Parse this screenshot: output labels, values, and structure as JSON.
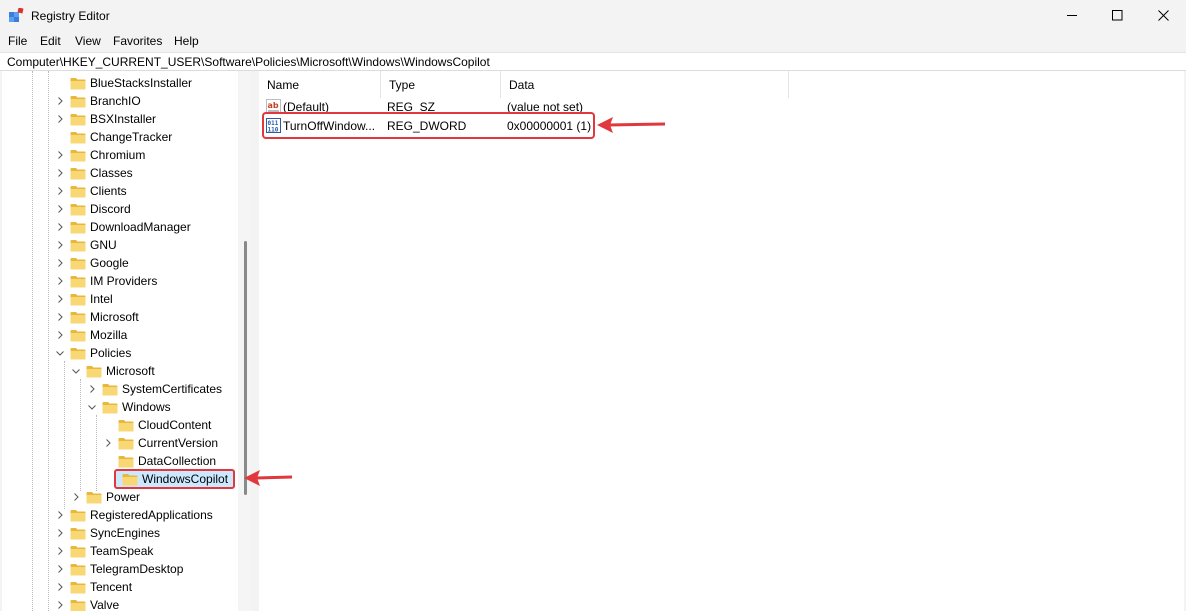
{
  "window": {
    "title": "Registry Editor",
    "controls": [
      "minimize",
      "maximize",
      "close"
    ]
  },
  "menu": [
    "File",
    "Edit",
    "View",
    "Favorites",
    "Help"
  ],
  "address": "Computer\\HKEY_CURRENT_USER\\Software\\Policies\\Microsoft\\Windows\\WindowsCopilot",
  "tree": [
    {
      "label": "BlueStacksInstaller",
      "level": 0,
      "chevron": "none"
    },
    {
      "label": "BranchIO",
      "level": 0,
      "chevron": "right"
    },
    {
      "label": "BSXInstaller",
      "level": 0,
      "chevron": "right"
    },
    {
      "label": "ChangeTracker",
      "level": 0,
      "chevron": "none"
    },
    {
      "label": "Chromium",
      "level": 0,
      "chevron": "right"
    },
    {
      "label": "Classes",
      "level": 0,
      "chevron": "right"
    },
    {
      "label": "Clients",
      "level": 0,
      "chevron": "right"
    },
    {
      "label": "Discord",
      "level": 0,
      "chevron": "right"
    },
    {
      "label": "DownloadManager",
      "level": 0,
      "chevron": "right"
    },
    {
      "label": "GNU",
      "level": 0,
      "chevron": "right"
    },
    {
      "label": "Google",
      "level": 0,
      "chevron": "right"
    },
    {
      "label": "IM Providers",
      "level": 0,
      "chevron": "right"
    },
    {
      "label": "Intel",
      "level": 0,
      "chevron": "right"
    },
    {
      "label": "Microsoft",
      "level": 0,
      "chevron": "right"
    },
    {
      "label": "Mozilla",
      "level": 0,
      "chevron": "right"
    },
    {
      "label": "Policies",
      "level": 0,
      "chevron": "down"
    },
    {
      "label": "Microsoft",
      "level": 1,
      "chevron": "down"
    },
    {
      "label": "SystemCertificates",
      "level": 2,
      "chevron": "right"
    },
    {
      "label": "Windows",
      "level": 2,
      "chevron": "down"
    },
    {
      "label": "CloudContent",
      "level": 3,
      "chevron": "none"
    },
    {
      "label": "CurrentVersion",
      "level": 3,
      "chevron": "right"
    },
    {
      "label": "DataCollection",
      "level": 3,
      "chevron": "none"
    },
    {
      "label": "WindowsCopilot",
      "level": 3,
      "chevron": "none",
      "selected": true
    },
    {
      "label": "Power",
      "level": 1,
      "chevron": "right"
    },
    {
      "label": "RegisteredApplications",
      "level": 0,
      "chevron": "right"
    },
    {
      "label": "SyncEngines",
      "level": 0,
      "chevron": "right"
    },
    {
      "label": "TeamSpeak",
      "level": 0,
      "chevron": "right"
    },
    {
      "label": "TelegramDesktop",
      "level": 0,
      "chevron": "right"
    },
    {
      "label": "Tencent",
      "level": 0,
      "chevron": "right"
    },
    {
      "label": "Valve",
      "level": 0,
      "chevron": "right"
    }
  ],
  "columns": [
    "Name",
    "Type",
    "Data"
  ],
  "values": [
    {
      "name": "(Default)",
      "type": "REG_SZ",
      "data": "(value not set)",
      "icon": "string-value-icon"
    },
    {
      "name": "TurnOffWindow...",
      "type": "REG_DWORD",
      "data": "0x00000001 (1)",
      "icon": "binary-value-icon"
    }
  ],
  "colors": {
    "highlight": "#e0383c",
    "selection": "#cce8ff",
    "folder": "#f8d775"
  }
}
